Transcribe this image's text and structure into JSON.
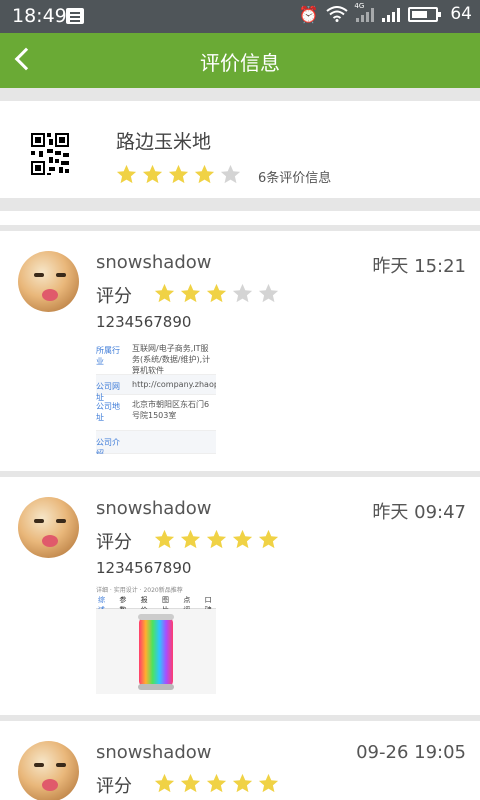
{
  "status_bar": {
    "time": "18:49",
    "network": "4G",
    "battery_level": "64",
    "icons": [
      "notification-icon",
      "alarm-icon",
      "wifi-icon",
      "signal-icon",
      "signal-icon",
      "battery-icon"
    ]
  },
  "header": {
    "title": "评价信息",
    "back_icon": "back-arrow-icon",
    "color": "#6aaa35"
  },
  "shop": {
    "name": "路边玉米地",
    "rating": 4,
    "max_rating": 5,
    "review_count_text": "6条评价信息"
  },
  "reviews": [
    {
      "user": "snowshadow",
      "time": "昨天 15:21",
      "score_label": "评分",
      "rating": 3,
      "text": "1234567890",
      "image": {
        "rows": [
          {
            "key": "所属行业",
            "value": "互联网/电子商务,IT服务(系统/数据/维护),计算机软件"
          },
          {
            "key": "公司网址",
            "value": "http://company.zhaopin"
          },
          {
            "key": "公司地址",
            "value": "北京市朝阳区东石门6号院1503室"
          },
          {
            "key": "公司介绍",
            "value": ""
          }
        ]
      }
    },
    {
      "user": "snowshadow",
      "time": "昨天 09:47",
      "score_label": "评分",
      "rating": 5,
      "text": "1234567890",
      "image": {
        "crumb": "详细 · 实用设计 · 2020新品推荐",
        "tabs": [
          "综述",
          "参数",
          "报价",
          "图片",
          "点评",
          "口碑"
        ]
      }
    },
    {
      "user": "snowshadow",
      "time": "09-26 19:05",
      "score_label": "评分",
      "rating": 5
    }
  ],
  "colors": {
    "star_filled": "#f0d245",
    "star_empty": "#d4d4d4",
    "divider": "#e6e6e6"
  }
}
